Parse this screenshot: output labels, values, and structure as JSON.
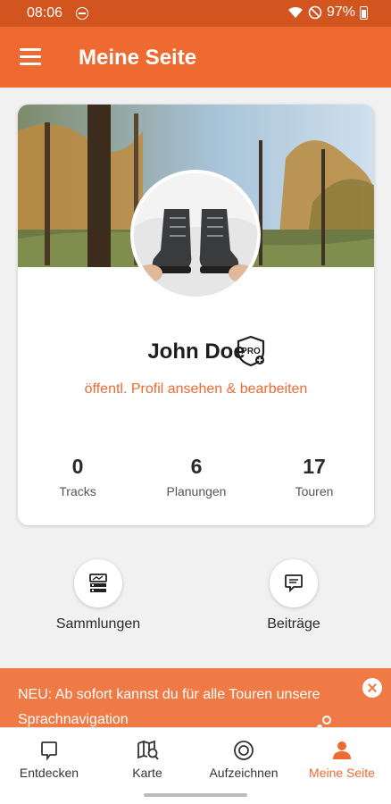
{
  "status_bar": {
    "time": "08:06",
    "battery": "97%"
  },
  "header": {
    "title": "Meine Seite"
  },
  "profile": {
    "name": "John Doe",
    "badge": "PRO",
    "link": "öffentl. Profil ansehen & bearbeiten",
    "stats": [
      {
        "value": "0",
        "label": "Tracks"
      },
      {
        "value": "6",
        "label": "Planungen"
      },
      {
        "value": "17",
        "label": "Touren"
      }
    ]
  },
  "quick_actions": [
    {
      "label": "Sammlungen",
      "icon": "collections-icon"
    },
    {
      "label": "Beiträge",
      "icon": "posts-icon"
    }
  ],
  "banner": {
    "text": "NEU: Ab sofort kannst du für alle Touren unsere Sprachnavigation"
  },
  "bottom_nav": [
    {
      "label": "Entdecken",
      "icon": "discover-icon"
    },
    {
      "label": "Karte",
      "icon": "map-search-icon"
    },
    {
      "label": "Aufzeichnen",
      "icon": "record-icon"
    },
    {
      "label": "Meine Seite",
      "icon": "profile-icon",
      "active": true
    }
  ],
  "colors": {
    "brand": "#ef6a31",
    "status_bar": "#d2541f",
    "banner": "#f07a45"
  }
}
